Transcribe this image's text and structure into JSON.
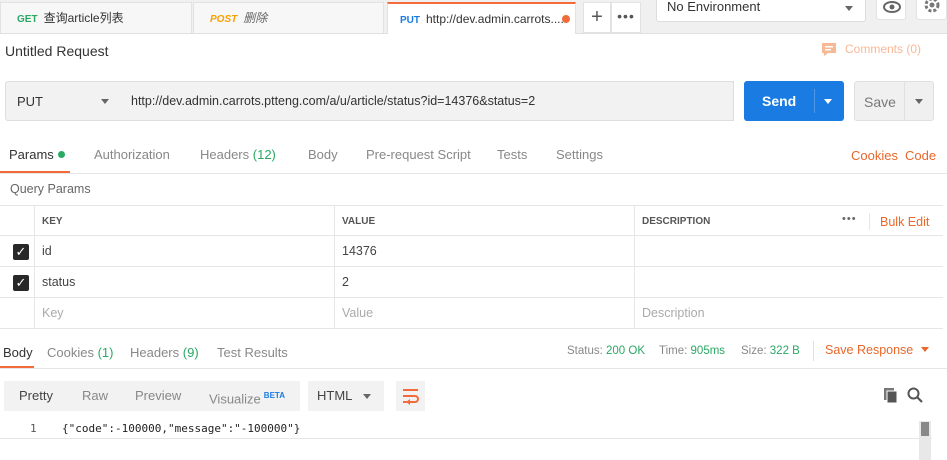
{
  "tabs": [
    {
      "method": "GET",
      "name": "查询article列表",
      "method_color": "#2aa864",
      "active": false
    },
    {
      "method": "POST",
      "name": "删除",
      "method_color": "#f7a100",
      "active": false
    },
    {
      "method": "PUT",
      "name": "http://dev.admin.carrots....",
      "method_color": "#1a7ce2",
      "active": true
    }
  ],
  "environment": {
    "selected": "No Environment"
  },
  "request": {
    "title": "Untitled Request",
    "comments_label": "Comments (0)",
    "method": "PUT",
    "url": "http://dev.admin.carrots.ptteng.com/a/u/article/status?id=14376&status=2",
    "send_label": "Send",
    "save_label": "Save"
  },
  "request_tabs": {
    "params": "Params",
    "authorization": "Authorization",
    "headers": "Headers",
    "headers_count": "(12)",
    "body": "Body",
    "prerequest": "Pre-request Script",
    "tests": "Tests",
    "settings": "Settings",
    "cookies": "Cookies",
    "code": "Code"
  },
  "query_params": {
    "section_label": "Query Params",
    "columns": {
      "key": "KEY",
      "value": "VALUE",
      "description": "DESCRIPTION"
    },
    "bulk_edit": "Bulk Edit",
    "rows": [
      {
        "checked": true,
        "key": "id",
        "value": "14376",
        "description": ""
      },
      {
        "checked": true,
        "key": "status",
        "value": "2",
        "description": ""
      }
    ],
    "placeholder": {
      "key": "Key",
      "value": "Value",
      "description": "Description"
    }
  },
  "response": {
    "tabs": {
      "body": "Body",
      "cookies": "Cookies",
      "cookies_count": "(1)",
      "headers": "Headers",
      "headers_count": "(9)",
      "test_results": "Test Results"
    },
    "status_label": "Status:",
    "status_value": "200 OK",
    "time_label": "Time:",
    "time_value": "905ms",
    "size_label": "Size:",
    "size_value": "322 B",
    "save_response": "Save Response",
    "view_modes": {
      "pretty": "Pretty",
      "raw": "Raw",
      "preview": "Preview",
      "visualize": "Visualize",
      "beta": "BETA"
    },
    "format": "HTML",
    "line_number": "1",
    "body_text": "{\"code\":-100000,\"message\":\"-100000\"}"
  },
  "colors": {
    "accent": "#f26b3a",
    "send": "#1a7ce2",
    "success": "#2aa864"
  }
}
